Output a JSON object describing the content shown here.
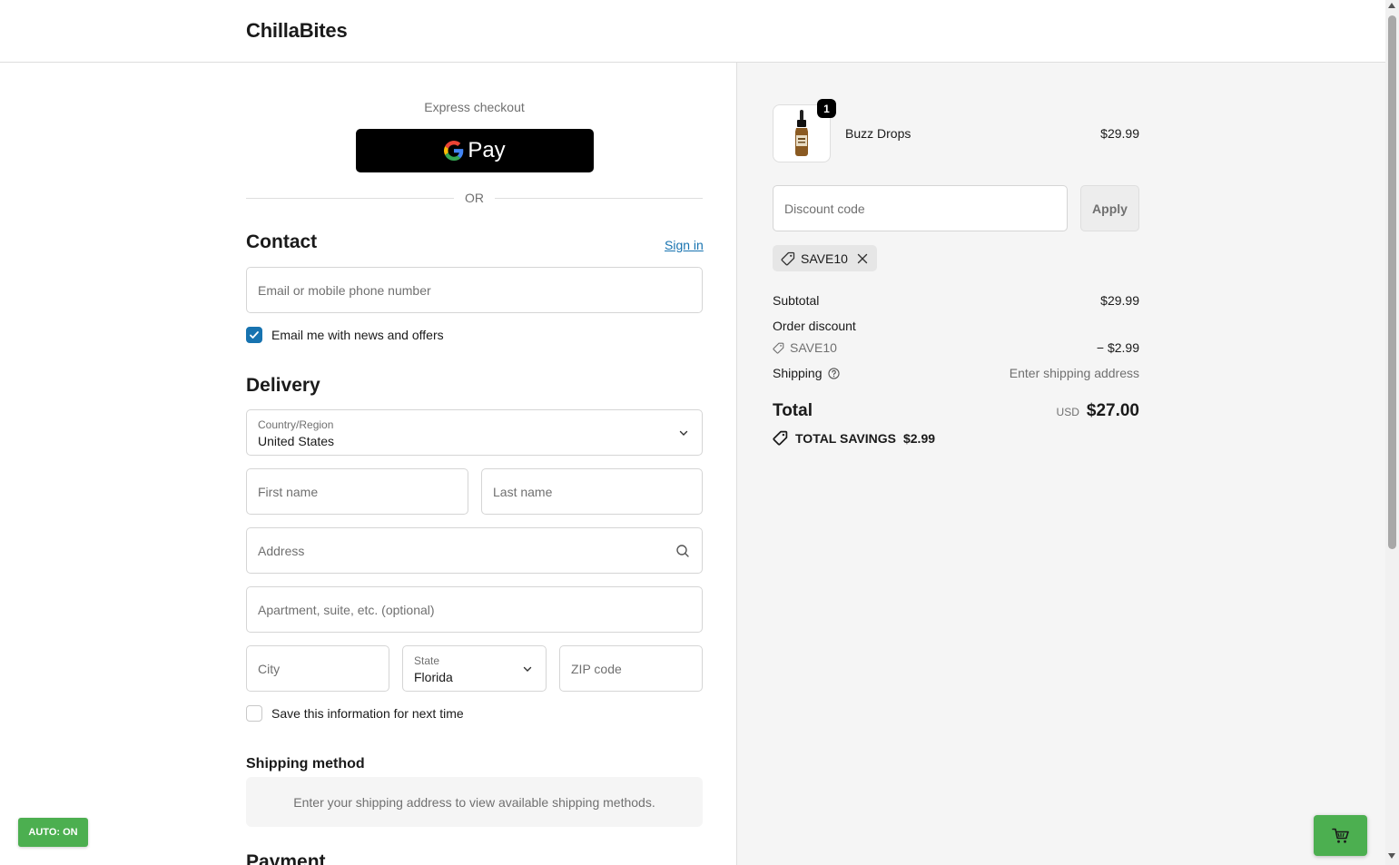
{
  "header": {
    "brand": "ChillaBites"
  },
  "express": {
    "label": "Express checkout",
    "gpay_label": "Pay",
    "or_label": "OR"
  },
  "contact": {
    "title": "Contact",
    "sign_in": "Sign in",
    "email_placeholder": "Email or mobile phone number",
    "news_label": "Email me with news and offers",
    "news_checked": true
  },
  "delivery": {
    "title": "Delivery",
    "country_label": "Country/Region",
    "country_value": "United States",
    "first_name_placeholder": "First name",
    "last_name_placeholder": "Last name",
    "address_placeholder": "Address",
    "apartment_placeholder": "Apartment, suite, etc. (optional)",
    "city_placeholder": "City",
    "state_label": "State",
    "state_value": "Florida",
    "zip_placeholder": "ZIP code",
    "save_info_label": "Save this information for next time",
    "save_info_checked": false
  },
  "shipping_method": {
    "title": "Shipping method",
    "message": "Enter your shipping address to view available shipping methods."
  },
  "payment": {
    "title": "Payment"
  },
  "auto_badge": "AUTO: ON",
  "summary": {
    "product": {
      "name": "Buzz Drops",
      "price": "$29.99",
      "quantity": "1"
    },
    "discount_placeholder": "Discount code",
    "apply_label": "Apply",
    "applied_code": "SAVE10",
    "subtotal_label": "Subtotal",
    "subtotal_value": "$29.99",
    "order_discount_label": "Order discount",
    "discount_code": "SAVE10",
    "discount_value": "− $2.99",
    "shipping_label": "Shipping",
    "shipping_value": "Enter shipping address",
    "total_label": "Total",
    "total_currency": "USD",
    "total_value": "$27.00",
    "savings_label": "TOTAL SAVINGS",
    "savings_value": "$2.99"
  },
  "colors": {
    "accent": "#1773b0",
    "badge_green": "#4caf50",
    "summary_bg": "#f5f5f5"
  }
}
